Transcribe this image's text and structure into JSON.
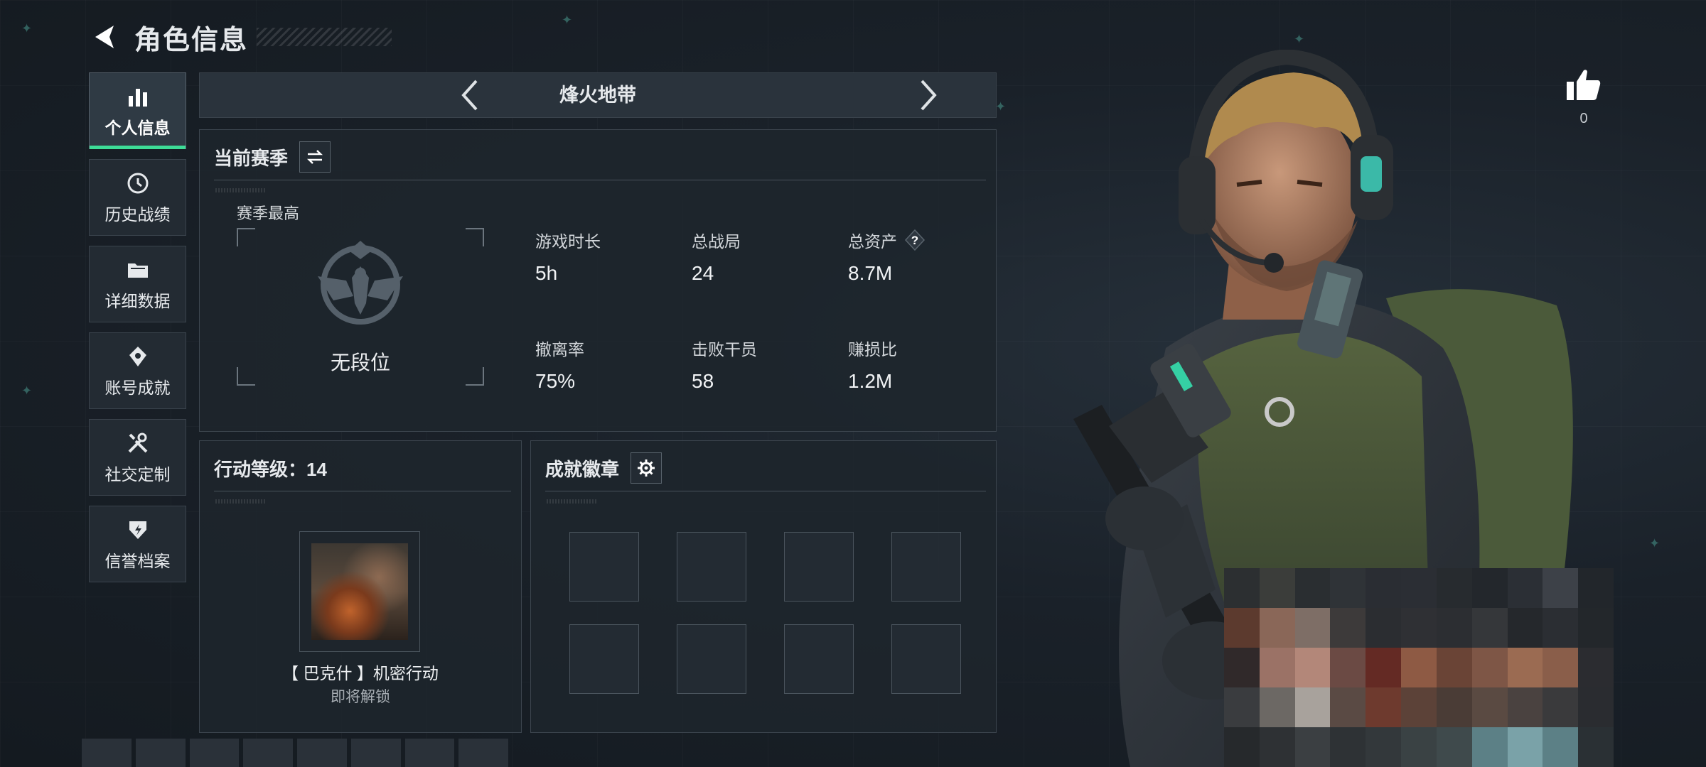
{
  "header": {
    "title": "角色信息"
  },
  "sidebar": {
    "items": [
      {
        "label": "个人信息",
        "active": true,
        "icon": "bar-chart-icon"
      },
      {
        "label": "历史战绩",
        "active": false,
        "icon": "history-icon"
      },
      {
        "label": "详细数据",
        "active": false,
        "icon": "folder-icon"
      },
      {
        "label": "账号成就",
        "active": false,
        "icon": "achievement-icon"
      },
      {
        "label": "社交定制",
        "active": false,
        "icon": "tools-icon"
      },
      {
        "label": "信誉档案",
        "active": false,
        "icon": "credit-icon"
      }
    ]
  },
  "mode": {
    "title": "烽火地带"
  },
  "season": {
    "heading": "当前赛季",
    "best_label": "赛季最高",
    "rank": "无段位",
    "stats": [
      {
        "label": "游戏时长",
        "value": "5h"
      },
      {
        "label": "总战局",
        "value": "24"
      },
      {
        "label": "总资产",
        "value": "8.7M",
        "help": "?"
      },
      {
        "label": "撤离率",
        "value": "75%"
      },
      {
        "label": "击败干员",
        "value": "58"
      },
      {
        "label": "赚损比",
        "value": "1.2M"
      }
    ]
  },
  "operations": {
    "heading": "行动等级：14",
    "op_name": "【 巴克什 】机密行动",
    "op_status": "即将解锁"
  },
  "badges": {
    "heading": "成就徽章",
    "slot_count": 8
  },
  "like": {
    "count": "0"
  },
  "colors": {
    "accent": "#3ddc97",
    "panel_bg": "#1e252c",
    "border": "#3c454e"
  }
}
